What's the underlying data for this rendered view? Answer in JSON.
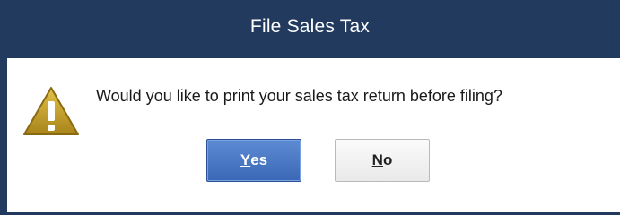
{
  "dialog": {
    "title": "File Sales Tax",
    "message": "Would you like to print your sales tax return before filing?",
    "icon": "warning-icon",
    "buttons": {
      "yes_mnemonic": "Y",
      "yes_rest": "es",
      "no_mnemonic": "N",
      "no_rest": "o"
    }
  },
  "colors": {
    "titlebar": "#223a5e",
    "primary_button": "#3a68b6",
    "warning_fill": "#c9a227"
  }
}
